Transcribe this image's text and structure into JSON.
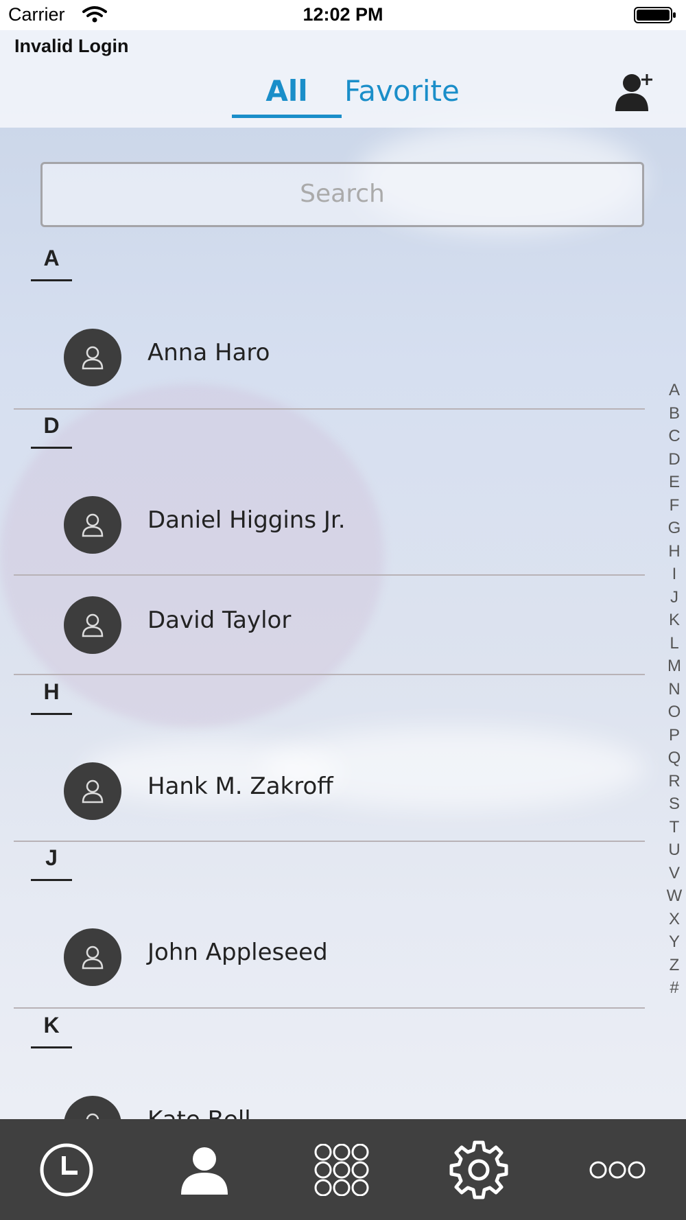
{
  "status_bar": {
    "carrier": "Carrier",
    "time": "12:02 PM"
  },
  "header": {
    "alert": "Invalid Login",
    "tabs": [
      {
        "label": "All",
        "selected": true
      },
      {
        "label": "Favorite",
        "selected": false
      }
    ],
    "add_contact_icon": "add-contact-icon",
    "accent_color": "#1a8ec9"
  },
  "search": {
    "placeholder": "Search"
  },
  "contacts": {
    "sections": [
      {
        "letter": "A",
        "names": [
          "Anna Haro"
        ]
      },
      {
        "letter": "D",
        "names": [
          "Daniel Higgins Jr.",
          "David Taylor"
        ]
      },
      {
        "letter": "H",
        "names": [
          "Hank M. Zakroff"
        ]
      },
      {
        "letter": "J",
        "names": [
          "John Appleseed"
        ]
      },
      {
        "letter": "K",
        "names": [
          "Kate Bell"
        ]
      }
    ]
  },
  "index_letters": [
    "A",
    "B",
    "C",
    "D",
    "E",
    "F",
    "G",
    "H",
    "I",
    "J",
    "K",
    "L",
    "M",
    "N",
    "O",
    "P",
    "Q",
    "R",
    "S",
    "T",
    "U",
    "V",
    "W",
    "X",
    "Y",
    "Z",
    "#"
  ],
  "tab_bar": {
    "items": [
      {
        "icon": "recents-clock-icon"
      },
      {
        "icon": "contacts-person-icon",
        "selected": true
      },
      {
        "icon": "keypad-icon"
      },
      {
        "icon": "settings-gear-icon"
      },
      {
        "icon": "more-icon"
      }
    ]
  }
}
